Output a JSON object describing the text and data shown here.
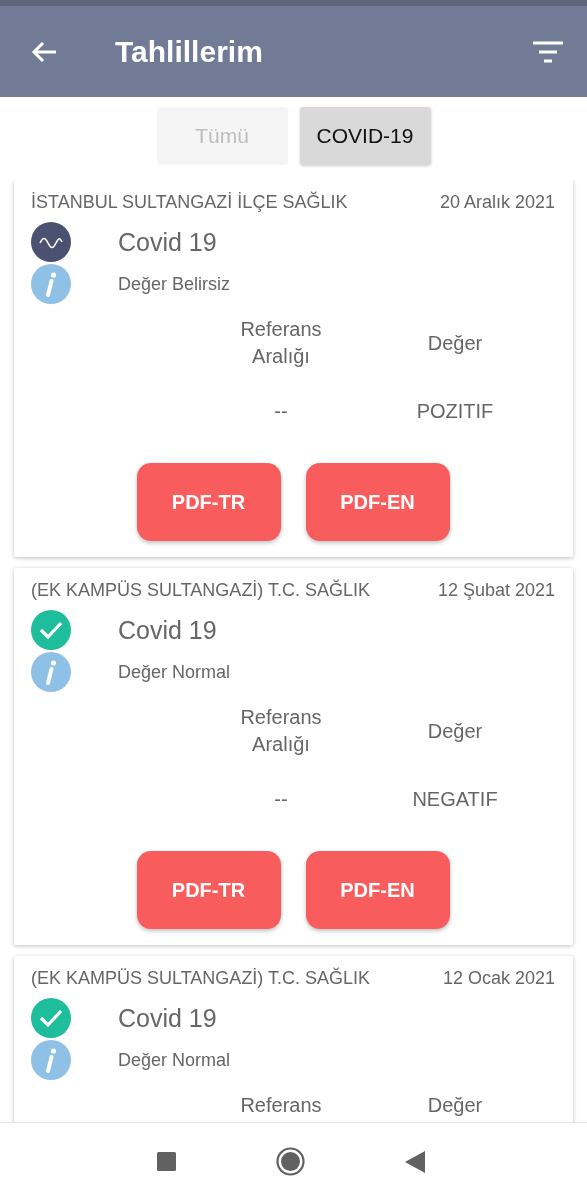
{
  "app_bar": {
    "title": "Tahlillerim"
  },
  "tabs": [
    {
      "label": "Tümü",
      "selected": false
    },
    {
      "label": "COVID-19",
      "selected": true
    }
  ],
  "results": [
    {
      "institution": "İSTANBUL SULTANGAZİ İLÇE SAĞLIK",
      "date": "20 Aralık 2021",
      "kind": "unclear",
      "test": "Covid 19",
      "note": "Değer Belirsiz",
      "reference_label": "Referans Aralığı",
      "value_label": "Değer",
      "reference": "--",
      "value": "POZITIF",
      "buttons": [
        "PDF-TR",
        "PDF-EN"
      ]
    },
    {
      "institution": "(EK KAMPÜS SULTANGAZİ) T.C. SAĞLIK",
      "date": "12 Şubat 2021",
      "kind": "normal",
      "test": "Covid 19",
      "note": "Değer Normal",
      "reference_label": "Referans Aralığı",
      "value_label": "Değer",
      "reference": "--",
      "value": "NEGATIF",
      "buttons": [
        "PDF-TR",
        "PDF-EN"
      ]
    },
    {
      "institution": "(EK KAMPÜS SULTANGAZİ) T.C. SAĞLIK",
      "date": "12 Ocak 2021",
      "kind": "normal",
      "test": "Covid 19",
      "note": "Değer Normal",
      "reference_label": "Referans",
      "value_label": "Değer"
    }
  ]
}
